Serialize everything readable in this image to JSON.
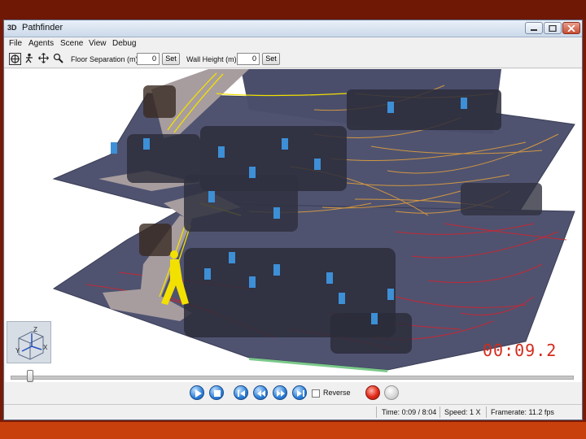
{
  "window": {
    "title": "Pathfinder",
    "app_icon": "3D"
  },
  "menu": [
    "File",
    "Agents",
    "Scene",
    "View",
    "Debug"
  ],
  "toolbar": {
    "tools": [
      "move-tool-icon",
      "agent-tool-icon",
      "pan-tool-icon",
      "zoom-tool-icon"
    ],
    "floor_separation_label": "Floor Separation (m):",
    "floor_separation_value": "0",
    "floor_set_label": "Set",
    "wall_height_label": "Wall Height (m):",
    "wall_height_value": "0",
    "wall_set_label": "Set"
  },
  "viewport": {
    "timer": "00:09.2",
    "axis": {
      "z": "Z",
      "x": "X",
      "y": "Y"
    },
    "colors": {
      "floor": "#4f5370",
      "upper_paths": "#e8a23a",
      "lower_paths": "#d9212b",
      "stairs": "#a79d9f",
      "highlight": "#f2e000"
    }
  },
  "playback": {
    "slider_position": 0.035,
    "reverse_label": "Reverse",
    "reverse_checked": false
  },
  "status": {
    "time": "Time: 0:09 / 8:04",
    "speed": "Speed: 1 X",
    "framerate": "Framerate: 11.2 fps"
  }
}
